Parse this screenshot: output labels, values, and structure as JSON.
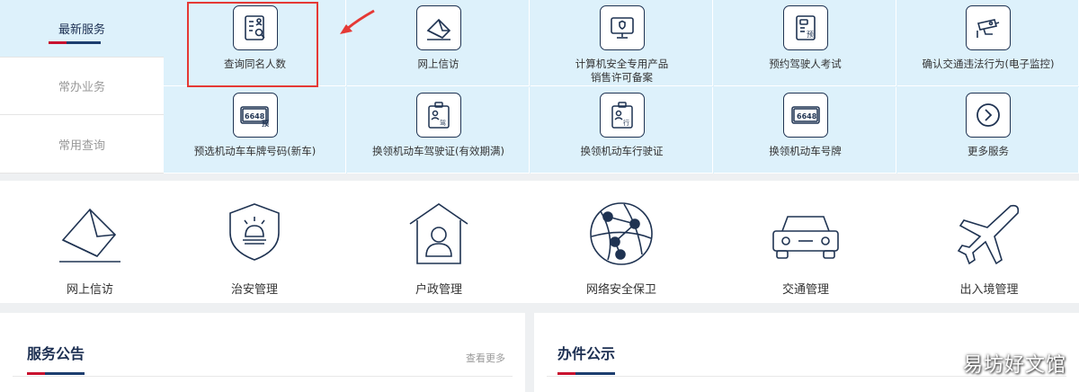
{
  "tabs": [
    {
      "label": "最新服务",
      "active": true
    },
    {
      "label": "常办业务",
      "active": false
    },
    {
      "label": "常用查询",
      "active": false
    }
  ],
  "services": [
    {
      "label": "查询同名人数",
      "icon": "name-search-icon"
    },
    {
      "label": "网上信访",
      "icon": "envelope-icon"
    },
    {
      "label": "计算机安全专用产品\n销售许可备案",
      "icon": "computer-shield-icon"
    },
    {
      "label": "预约驾驶人考试",
      "icon": "driver-exam-icon"
    },
    {
      "label": "确认交通违法行为(电子监控)",
      "icon": "surveillance-camera-icon"
    },
    {
      "label": "预选机动车车牌号码(新车)",
      "icon": "plate-preselect-icon"
    },
    {
      "label": "换领机动车驾驶证(有效期满)",
      "icon": "driver-license-icon"
    },
    {
      "label": "换领机动车行驶证",
      "icon": "vehicle-license-icon"
    },
    {
      "label": "换领机动车号牌",
      "icon": "license-plate-icon"
    },
    {
      "label": "更多服务",
      "icon": "chevron-right-circle-icon"
    }
  ],
  "plate_text": "6648",
  "plate_badge_pre": "预",
  "badge_jia": "驾",
  "badge_xing": "行",
  "categories": [
    {
      "label": "网上信访",
      "icon": "envelope-icon"
    },
    {
      "label": "治安管理",
      "icon": "police-shield-icon"
    },
    {
      "label": "户政管理",
      "icon": "household-icon"
    },
    {
      "label": "网络安全保卫",
      "icon": "network-globe-icon"
    },
    {
      "label": "交通管理",
      "icon": "car-icon"
    },
    {
      "label": "出入境管理",
      "icon": "airplane-icon"
    }
  ],
  "panels": {
    "notice": {
      "title": "服务公告",
      "more": "查看更多"
    },
    "publicity": {
      "title": "办件公示"
    }
  },
  "watermark": "易坊好文馆",
  "colors": {
    "navy": "#1c2f52",
    "red": "#c8102e",
    "light_blue": "#ddf1fb",
    "highlight": "#e53935"
  }
}
